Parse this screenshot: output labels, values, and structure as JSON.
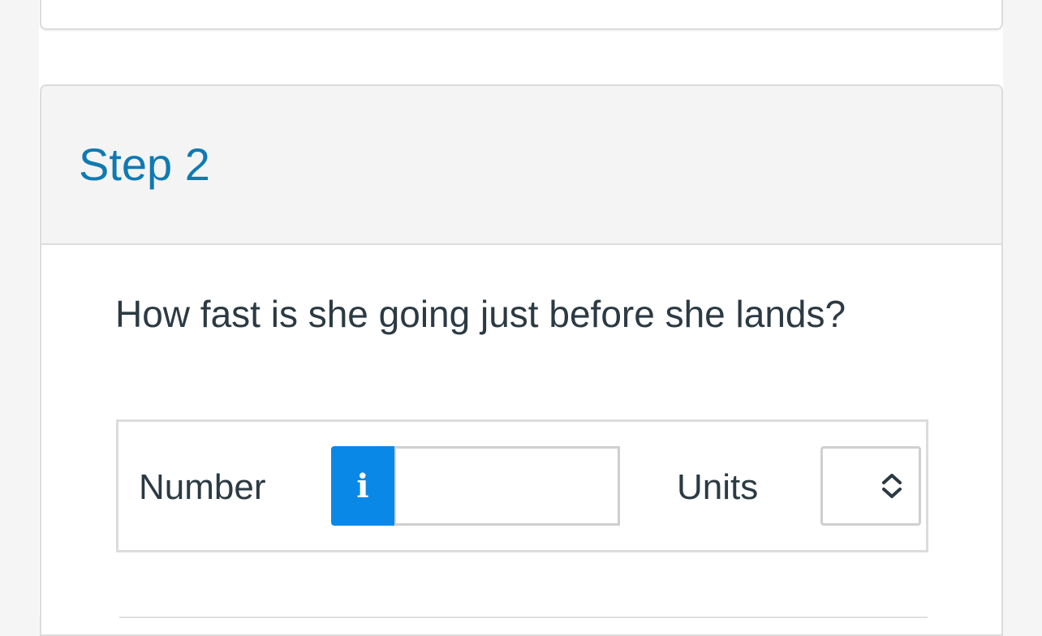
{
  "step": {
    "title": "Step 2",
    "question": "How fast is she going just before she lands?"
  },
  "answer": {
    "number_label": "Number",
    "info_icon_glyph": "i",
    "number_value": "",
    "units_label": "Units",
    "units_selected": "",
    "icons": {
      "info": "info-icon",
      "select": "chevron-up-down-icon"
    },
    "colors": {
      "accent_title": "#0f7ab2",
      "info_button": "#0a88e8",
      "text": "#2b3a43"
    }
  }
}
